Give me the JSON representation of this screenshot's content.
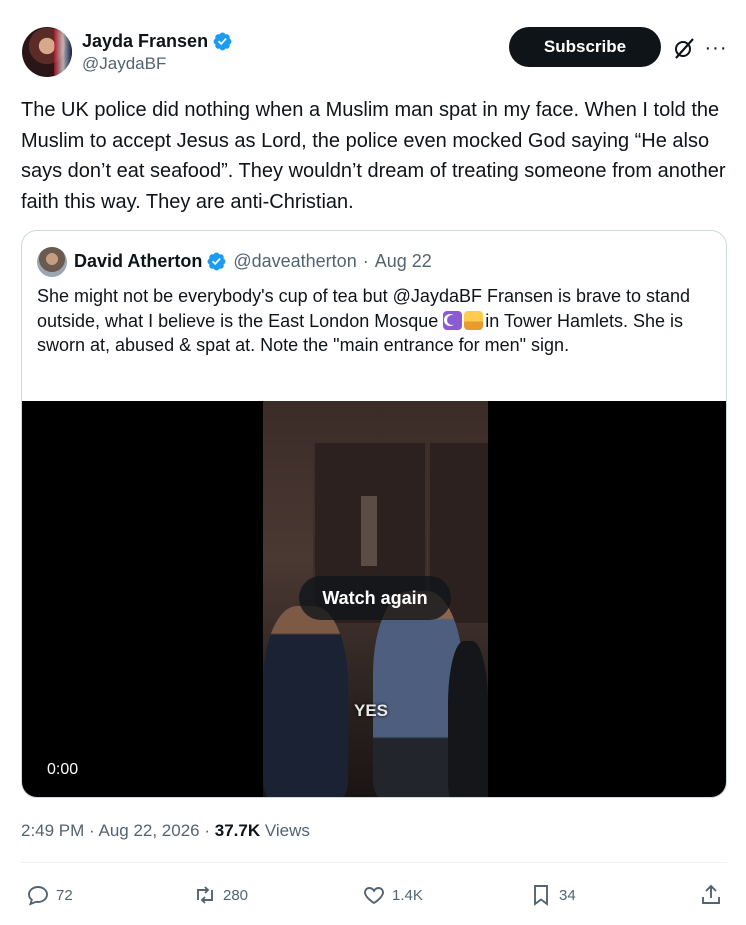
{
  "author": {
    "name": "Jayda Fransen",
    "handle": "@JaydaBF",
    "verified": true
  },
  "header": {
    "subscribe_label": "Subscribe",
    "more_label": "···"
  },
  "tweet": {
    "text": "The UK police did nothing when a Muslim man spat in my face. When I told the Muslim to accept Jesus as Lord, the police even mocked God saying “He also says don’t eat seafood”. They wouldn’t dream of treating someone from another faith this way. They are anti-Christian."
  },
  "quote": {
    "name": "David Atherton",
    "handle": "@daveatherton",
    "dot": "·",
    "date": "Aug 22",
    "text_part1": "She might not be everybody's cup of tea but @JaydaBF Fransen is brave to stand outside, what I believe is the East London Mosque ",
    "text_part2": "in Tower Hamlets. She is sworn at, abused & spat at. Note the \"main entrance for men\" sign.",
    "video": {
      "overlay_button": "Watch again",
      "caption": "YES",
      "time": "0:00"
    }
  },
  "meta": {
    "time": "2:49 PM",
    "sep1": " · ",
    "date": "Aug 22, 2026",
    "sep2": " · ",
    "views_count": "37.7K",
    "views_label": " Views"
  },
  "actions": {
    "replies": "72",
    "reposts": "280",
    "likes": "1.4K",
    "bookmarks": "34"
  },
  "colors": {
    "text": "#0f1419",
    "muted": "#536471",
    "verified": "#1d9bf0",
    "border": "#cfd9de"
  },
  "icons": [
    "verified-badge-icon",
    "grok-icon",
    "more-icon",
    "reply-icon",
    "repost-icon",
    "like-icon",
    "bookmark-icon",
    "share-icon",
    "crescent-emoji-icon",
    "mosque-emoji-icon"
  ]
}
